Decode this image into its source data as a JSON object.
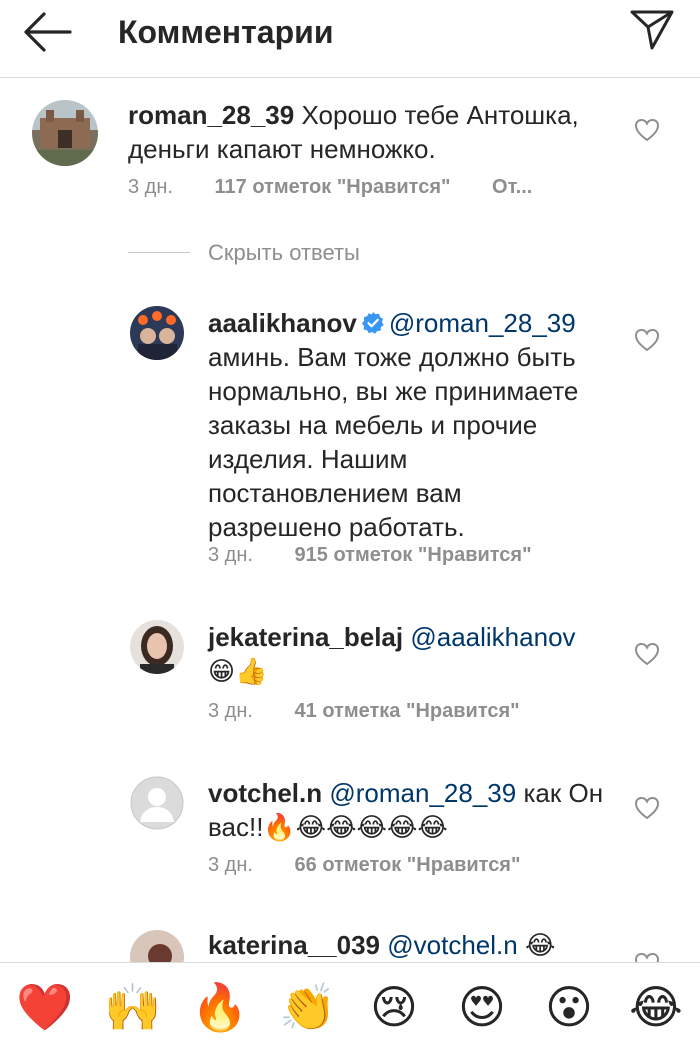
{
  "header": {
    "title": "Комментарии",
    "back_icon": "arrow-left-icon",
    "send_icon": "paper-plane-icon"
  },
  "thread": {
    "root": {
      "username": "roman_28_39",
      "text": "Хорошо тебе Антошка, деньги капают немножко.",
      "time": "3 дн.",
      "likes": "117 отметок \"Нравится\"",
      "reply": "От..."
    },
    "hide_replies_label": "Скрыть ответы",
    "replies": [
      {
        "username": "aaalikhanov",
        "verified": true,
        "mention": "@roman_28_39",
        "text": "аминь. Вам тоже должно быть нормально, вы же принимаете заказы на мебель и прочие изделия. Нашим постановлением вам разрешено работать.",
        "time": "3 дн.",
        "likes": "915 отметок \"Нравится\""
      },
      {
        "username": "jekaterina_belaj",
        "mention": "@aaalikhanov",
        "text": "😁👍",
        "time": "3 дн.",
        "likes": "41 отметка \"Нравится\""
      },
      {
        "username": "votchel.n",
        "mention": "@roman_28_39",
        "text": "как Он вас!!🔥😂😂😂😂😂",
        "time": "3 дн.",
        "likes": "66 отметок \"Нравится\""
      },
      {
        "username": "katerina__039",
        "mention": "@votchel.n",
        "text": "😂"
      }
    ]
  },
  "emoji_bar": {
    "emojis": [
      "❤️",
      "🙌",
      "🔥",
      "👏",
      "😢",
      "😍",
      "😮",
      "😂"
    ]
  },
  "colors": {
    "text": "#262626",
    "muted": "#8e8e8e",
    "mention": "#00376b",
    "verified": "#3897f0",
    "divider": "#dbdbdb"
  }
}
